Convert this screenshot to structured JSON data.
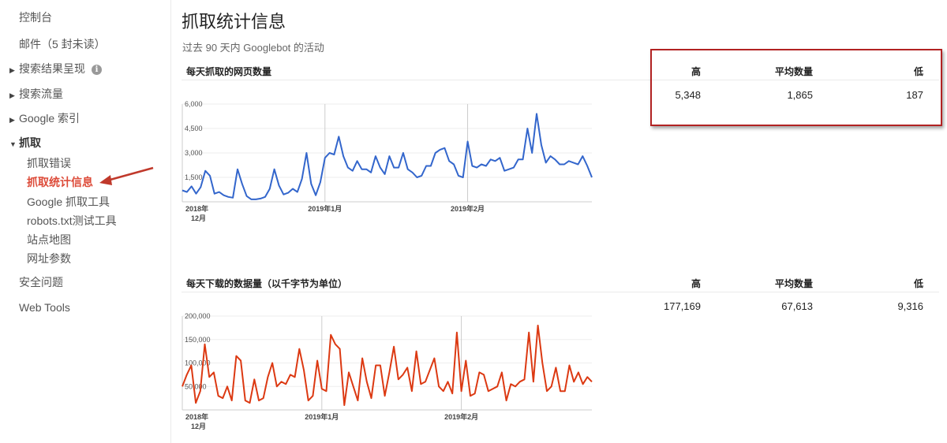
{
  "sidebar": {
    "dashboard": "控制台",
    "messages": "邮件（5 封未读）",
    "search_appearance": "搜索结果呈现",
    "search_traffic": "搜索流量",
    "google_index": "Google 索引",
    "crawl": "抓取",
    "crawl_items": [
      "抓取错误",
      "抓取统计信息",
      "Google 抓取工具",
      "robots.txt测试工具",
      "站点地图",
      "网址参数"
    ],
    "security": "安全问题",
    "web_tools": "Web Tools",
    "icons": {
      "expand": "triangle-right-icon",
      "collapse": "triangle-down-icon",
      "info": "info-icon",
      "pointer": "red-arrow-icon"
    }
  },
  "header": {
    "title": "抓取统计信息",
    "subtitle": "过去 90 天内 Googlebot 的活动"
  },
  "sections": [
    {
      "title": "每天抓取的网页数量",
      "stat_labels": {
        "high": "高",
        "avg": "平均数量",
        "low": "低"
      },
      "stats": {
        "high": "5,348",
        "avg": "1,865",
        "low": "187"
      }
    },
    {
      "title": "每天下载的数据量（以千字节为单位）",
      "stat_labels": {
        "high": "高",
        "avg": "平均数量",
        "low": "低"
      },
      "stats": {
        "high": "177,169",
        "avg": "67,613",
        "low": "9,316"
      }
    }
  ],
  "colors": {
    "accent_red": "#dd4b39",
    "series1": "#3366cc",
    "series2": "#dc3912",
    "highlight_box": "#b22222"
  },
  "chart_data": [
    {
      "type": "line",
      "title": "",
      "x_labels": [
        {
          "text": "2018年",
          "text2": "12月",
          "day": 0
        },
        {
          "text": "2019年1月",
          "text2": "",
          "day": 31
        },
        {
          "text": "2019年2月",
          "text2": "",
          "day": 62
        }
      ],
      "y_ticks": [
        "1,500",
        "3,000",
        "4,500",
        "6,000"
      ],
      "ylim": [
        0,
        6000
      ],
      "grid": true,
      "color": "#3366cc",
      "values": [
        700,
        600,
        950,
        500,
        900,
        1900,
        1600,
        500,
        600,
        400,
        300,
        250,
        2000,
        1100,
        350,
        150,
        150,
        200,
        300,
        800,
        2000,
        1000,
        450,
        550,
        800,
        600,
        1400,
        3000,
        1100,
        400,
        1200,
        2700,
        3000,
        2900,
        4000,
        2800,
        2100,
        1900,
        2500,
        2000,
        2000,
        1800,
        2800,
        2100,
        1700,
        2800,
        2100,
        2100,
        3000,
        2000,
        1800,
        1500,
        1600,
        2200,
        2200,
        3000,
        3200,
        3300,
        2500,
        2300,
        1600,
        1500,
        3700,
        2200,
        2100,
        2300,
        2200,
        2600,
        2500,
        2700,
        1900,
        2000,
        2100,
        2600,
        2600,
        4500,
        3000,
        5400,
        3500,
        2400,
        2800,
        2600,
        2300,
        2300,
        2500,
        2400,
        2300,
        2800,
        2200,
        1500
      ]
    },
    {
      "type": "line",
      "title": "",
      "x_labels": [
        {
          "text": "2018年",
          "text2": "12月",
          "day": 0
        },
        {
          "text": "2019年1月",
          "text2": "",
          "day": 31
        },
        {
          "text": "2019年2月",
          "text2": "",
          "day": 62
        }
      ],
      "y_ticks": [
        "50,000",
        "100,000",
        "150,000",
        "200,000"
      ],
      "ylim": [
        0,
        200000
      ],
      "grid": true,
      "color": "#dc3912",
      "values": [
        50000,
        75000,
        95000,
        15000,
        40000,
        140000,
        70000,
        80000,
        30000,
        25000,
        50000,
        20000,
        115000,
        105000,
        20000,
        15000,
        65000,
        20000,
        25000,
        70000,
        100000,
        50000,
        60000,
        55000,
        75000,
        70000,
        130000,
        85000,
        20000,
        30000,
        105000,
        45000,
        40000,
        160000,
        140000,
        130000,
        10000,
        80000,
        50000,
        20000,
        110000,
        60000,
        25000,
        95000,
        95000,
        30000,
        80000,
        135000,
        65000,
        75000,
        90000,
        40000,
        125000,
        55000,
        60000,
        85000,
        110000,
        50000,
        40000,
        60000,
        35000,
        165000,
        40000,
        105000,
        30000,
        35000,
        80000,
        75000,
        40000,
        45000,
        50000,
        80000,
        20000,
        55000,
        50000,
        60000,
        65000,
        165000,
        60000,
        180000,
        100000,
        40000,
        50000,
        90000,
        40000,
        40000,
        95000,
        60000,
        80000,
        55000,
        70000,
        60000
      ]
    }
  ]
}
